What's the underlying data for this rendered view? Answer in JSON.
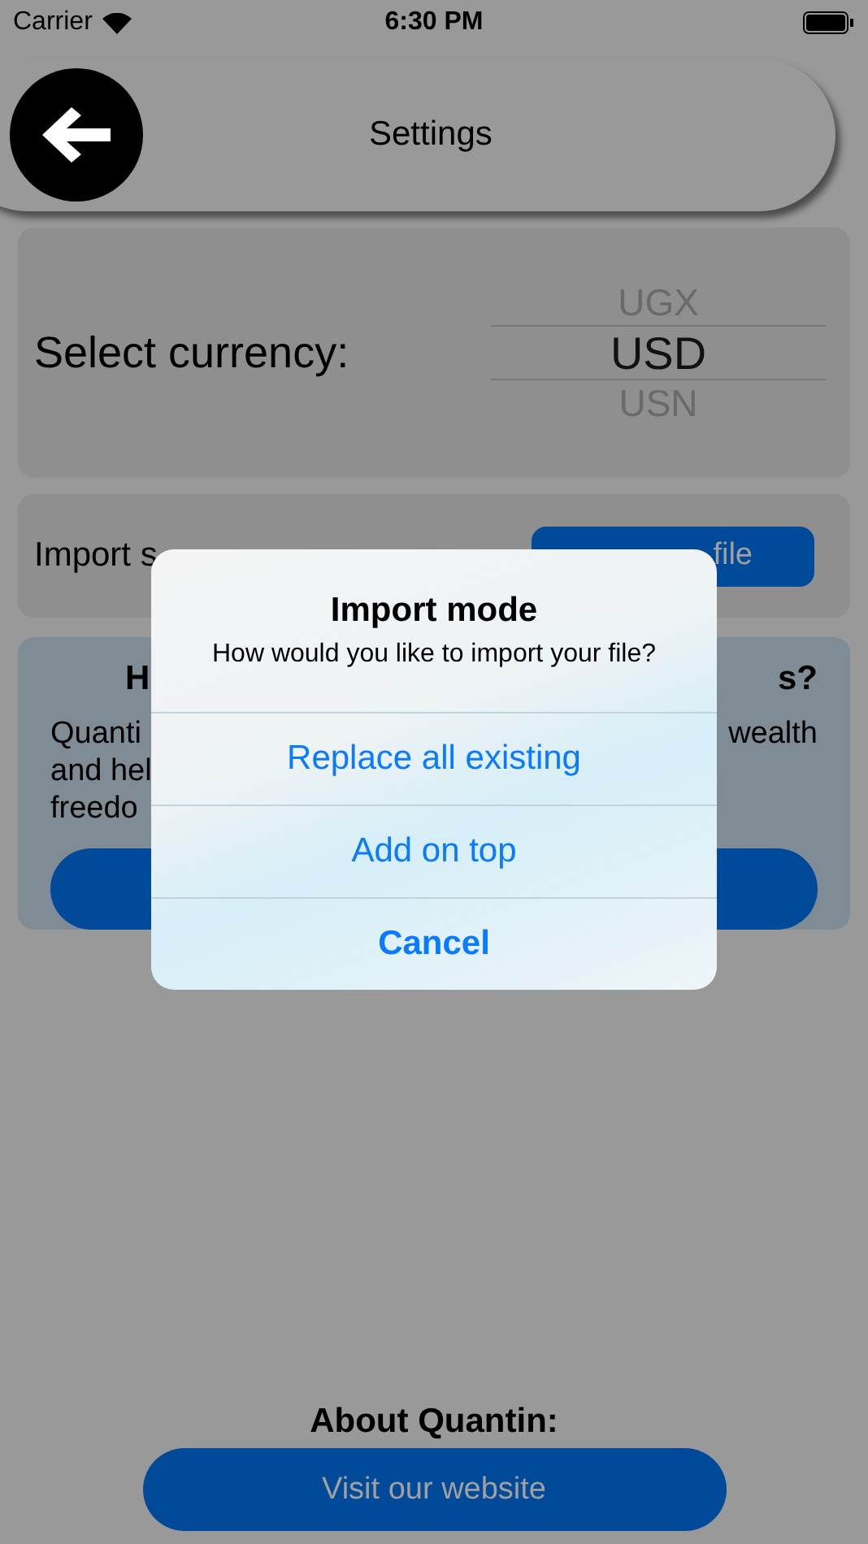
{
  "status_bar": {
    "carrier": "Carrier",
    "time": "6:30 PM"
  },
  "nav": {
    "title": "Settings"
  },
  "currency": {
    "label": "Select currency:",
    "options": [
      {
        "label": "UGX",
        "selected": false
      },
      {
        "label": "USD",
        "selected": true
      },
      {
        "label": "USN",
        "selected": false
      }
    ]
  },
  "import": {
    "label_visible": "Import s",
    "button_visible": "file"
  },
  "info_card": {
    "heading_left": "H",
    "heading_right": "s?",
    "lines": [
      {
        "left": "Quanti",
        "right": "wealth"
      },
      {
        "left": "and hel"
      },
      {
        "left": "freedo"
      }
    ]
  },
  "about": {
    "heading": "About Quantin:",
    "button": "Visit our website"
  },
  "dialog": {
    "title": "Import mode",
    "message": "How would you like to import your file?",
    "actions": [
      {
        "label": "Replace all existing",
        "kind": "default"
      },
      {
        "label": "Add on top",
        "kind": "default"
      },
      {
        "label": "Cancel",
        "kind": "cancel"
      }
    ]
  }
}
